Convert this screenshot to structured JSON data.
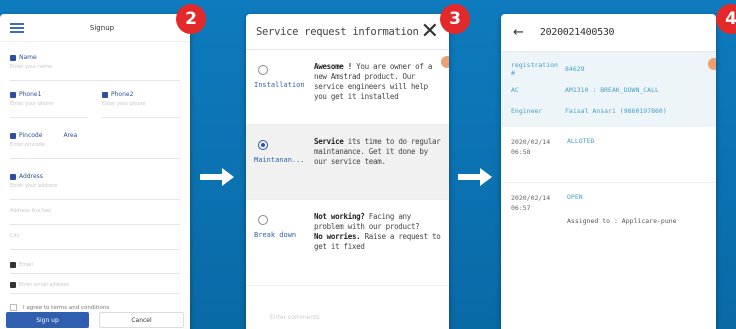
{
  "colors": {
    "background": "#0b73b3",
    "badge": "#e32929",
    "link_blue": "#2f62b3",
    "info_cyan": "#4aa0c8",
    "primary_button": "#2f5fae"
  },
  "steps": [
    "2",
    "3",
    "4"
  ],
  "signup": {
    "title": "Signup",
    "fields": {
      "name_label": "Name",
      "name_placeholder": "Enter your name",
      "phone1_label": "Phone1",
      "phone1_placeholder": "Enter your phone",
      "phone2_label": "Phone2",
      "phone2_placeholder": "Enter your phone",
      "pincode_label": "Pincode",
      "area_label": "Area",
      "pincode_placeholder": "Enter pincode",
      "address_label": "Address",
      "address_placeholder": "Enter your address",
      "address2_placeholder": "Address line two",
      "city_placeholder": "City",
      "email_placeholder": "Email",
      "email2_placeholder": "Enter email address"
    },
    "terms_label": "I agree to terms and conditions",
    "signup_button": "Sign up",
    "cancel_button": "Cancel"
  },
  "service_request": {
    "title": "Service request information",
    "options": [
      {
        "label": "Installation",
        "selected": false,
        "bold": "Awesome !",
        "text": " You are owner of a new Amstrad product. Our service engineers will help you get it installed"
      },
      {
        "label": "Maintanan...",
        "selected": true,
        "bold": "Service",
        "text": " its time to do regular maintanance. Get it done by our service team."
      },
      {
        "label": "Break down",
        "selected": false,
        "bold": "Not working?",
        "text": " Facing any problem with our product?",
        "bold2": "No worries.",
        "text2": " Raise a request to get it fixed"
      }
    ],
    "comments_placeholder": "Enter comments"
  },
  "ticket": {
    "title": "2020021400530",
    "info": [
      {
        "key": "registration #",
        "value": "84629"
      },
      {
        "key": "AC",
        "value": "AM1310 : BREAK_DOWN_CALL"
      },
      {
        "key": "Engineer",
        "value": "Faisal Ansari (9860197860)"
      }
    ],
    "events": [
      {
        "date": "2020/02/14",
        "time": "06:58",
        "status": "ALLOTED",
        "note": ""
      },
      {
        "date": "2020/02/14",
        "time": "06:57",
        "status": "OPEN",
        "note": "Assigned to : Applicare-pune"
      }
    ]
  }
}
